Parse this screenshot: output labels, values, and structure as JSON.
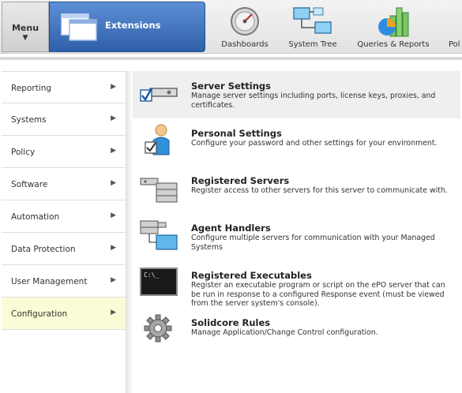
{
  "toolbar": {
    "menu_label": "Menu",
    "menu_arrow": "▼",
    "extensions_label": "Extensions",
    "tools": [
      {
        "label": "Dashboards",
        "icon": "gauge-icon"
      },
      {
        "label": "System Tree",
        "icon": "network-tree-icon"
      },
      {
        "label": "Queries & Reports",
        "icon": "pie-bar-chart-icon"
      },
      {
        "label": "Pol",
        "icon": "policy-icon"
      }
    ]
  },
  "sidebar": {
    "chevron": "▶",
    "items": [
      {
        "label": "Reporting"
      },
      {
        "label": "Systems"
      },
      {
        "label": "Policy"
      },
      {
        "label": "Software"
      },
      {
        "label": "Automation"
      },
      {
        "label": "Data Protection"
      },
      {
        "label": "User Management"
      },
      {
        "label": "Configuration",
        "active": true
      }
    ]
  },
  "content": {
    "entries": [
      {
        "title": "Server Settings",
        "desc": "Manage server settings including ports, license keys, proxies, and certificates.",
        "icon": "server-settings-icon",
        "highlighted": true
      },
      {
        "title": "Personal Settings",
        "desc": "Configure your password and other settings for your environment.",
        "icon": "personal-settings-icon"
      },
      {
        "title": "Registered Servers",
        "desc": "Register access to other servers for this server to communicate with.",
        "icon": "registered-servers-icon"
      },
      {
        "title": "Agent Handlers",
        "desc": "Configure multiple servers for communication with your Managed Systems",
        "icon": "agent-handlers-icon"
      },
      {
        "title": "Registered Executables",
        "desc": "Register an executable program or script on the ePO server that can be run in response to a configured Response event (must be viewed from the server system's console).",
        "icon": "terminal-icon"
      },
      {
        "title": "Solidcore Rules",
        "desc": "Manage Application/Change Control configuration.",
        "icon": "gear-icon"
      }
    ]
  },
  "colors": {
    "accent_blue": "#2f5fa9",
    "active_item_bg": "#fbfbd6",
    "highlight_bg": "#efefef"
  }
}
